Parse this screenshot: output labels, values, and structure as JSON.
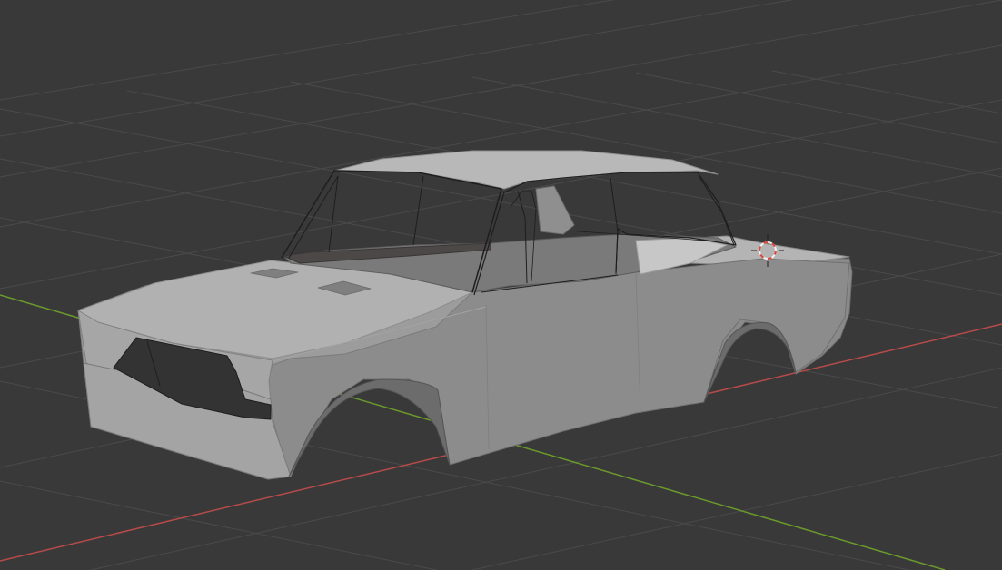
{
  "viewport": {
    "background_color": "#393939",
    "grid_color": "#4a4a4a",
    "x_axis_color": "#b84a4a",
    "y_axis_color": "#6b9a2b",
    "mesh_base_color": "#9d9d9d",
    "mesh_edge_color": "#1e1e1e",
    "cursor_colors": [
      "#d94a3a",
      "#f0f0f0"
    ]
  },
  "scene": {
    "object": "car-body-mesh",
    "shading": "solid",
    "cursor": "3d-cursor-icon"
  }
}
